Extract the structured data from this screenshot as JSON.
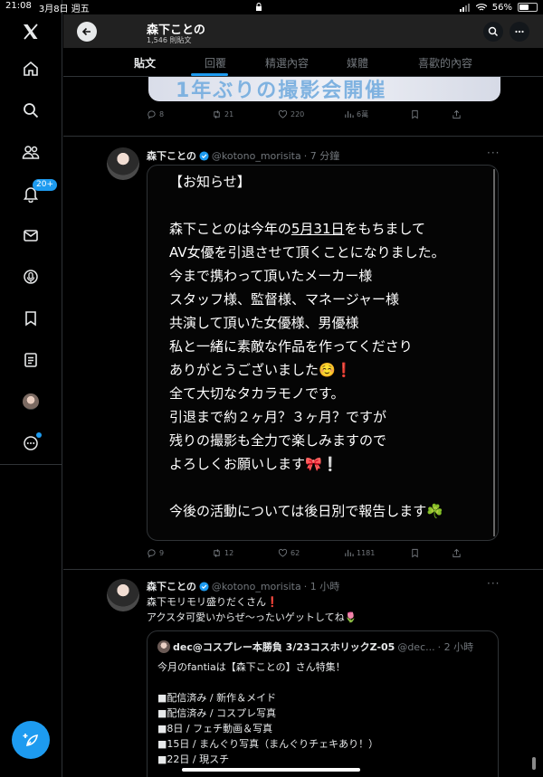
{
  "status_bar": {
    "time": "21:08",
    "date": "3月8日 週五",
    "battery": "56%",
    "battery_level": 0.56
  },
  "nav": {
    "notification_badge": "20+"
  },
  "profile_header": {
    "name": "森下ことの",
    "post_count": "1,546 則貼文"
  },
  "tabs": [
    "貼文",
    "回覆",
    "精選內容",
    "媒體",
    "喜歡的內容"
  ],
  "prev_tweet": {
    "banner_text": "1年ぶりの撮影会開催",
    "stats": {
      "replies": "8",
      "retweets": "21",
      "likes": "220",
      "views": "6萬"
    }
  },
  "tweet1": {
    "name": "森下ことの",
    "handle": "@kotono_morisita",
    "time": "· 7 分鐘",
    "image_text": {
      "l1": "【お知らせ】",
      "l2a": "森下ことのは今年の",
      "l2b": "5月31日",
      "l2c": "をもちまして",
      "l3": "AV女優を引退させて頂くことになりました。",
      "l4": "今まで携わって頂いたメーカー様",
      "l5": "スタッフ様、監督様、マネージャー様",
      "l6": "共演して頂いた女優様、男優様",
      "l7": "私と一緒に素敵な作品を作ってくださり",
      "l8": "ありがとうございました☺️❗️",
      "l9": "全て大切なタカラモノです。",
      "l10": "引退まで約２ヶ月？３ヶ月？ですが",
      "l11": "残りの撮影も全力で楽しみますので",
      "l12": "よろしくお願いします🎀❕",
      "l13": "今後の活動については後日別で報告します☘️"
    },
    "stats": {
      "replies": "9",
      "retweets": "12",
      "likes": "62",
      "views": "1181"
    }
  },
  "tweet2": {
    "name": "森下ことの",
    "handle": "@kotono_morisita",
    "time": "· 1 小時",
    "line1": "森下モリモリ盛りだくさん❗️",
    "line2": "アクスタ可愛いからぜ〜ったいゲットしてね🌷",
    "quote": {
      "name": "dec@コスプレー本勝負 3/23コスホリックZ-05",
      "handle": "@dec...",
      "time": "· 2 小時",
      "l1": "今月のfantiaは【森下ことの】さん特集！",
      "l2": "■配信済み / 新作＆メイド",
      "l3": "■配信済み / コスプレ写真",
      "l4": "■8日 / フェチ動画＆写真",
      "l5": "■15日 / まんぐり写真（まんぐりチェキあり！）",
      "l6": "■22日 / 現スチ"
    }
  },
  "colors": {
    "accent": "#1d9bf0",
    "background": "#000000",
    "text": "#e7e9ea",
    "muted": "#71767b",
    "border": "#2f3336"
  }
}
